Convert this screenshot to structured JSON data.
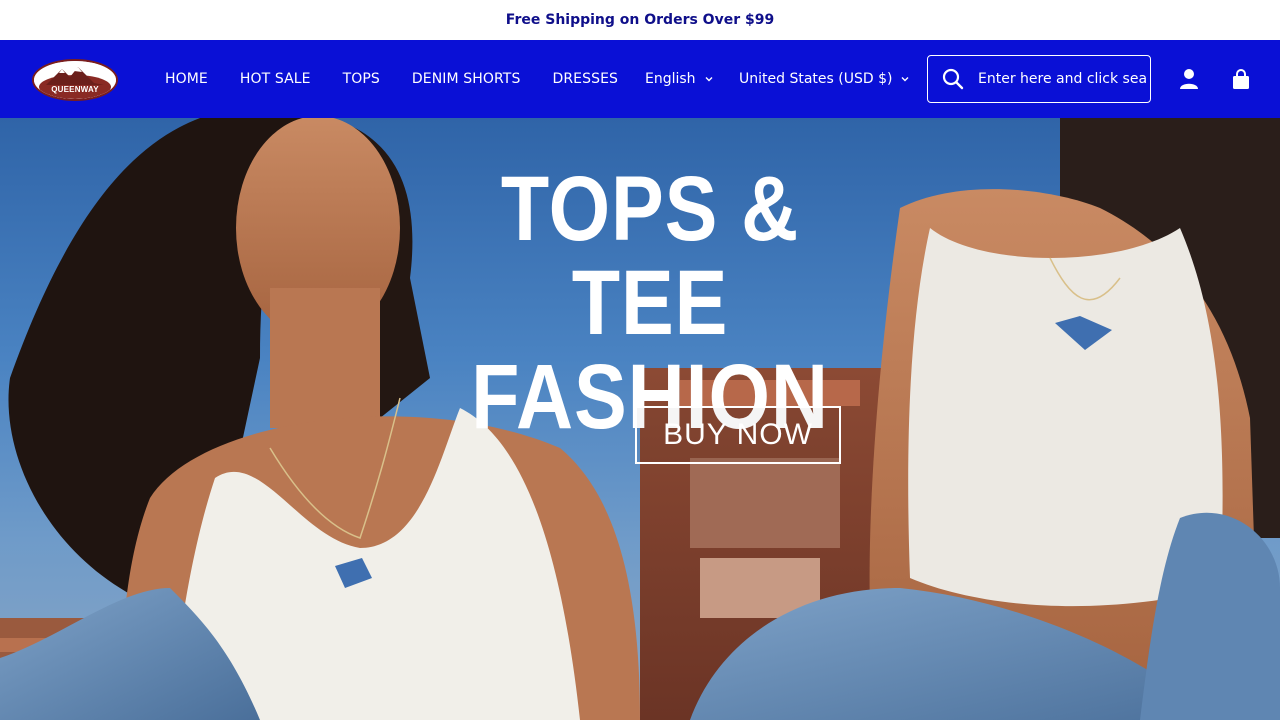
{
  "announcement": {
    "text": "Free Shipping on Orders Over $99"
  },
  "header": {
    "logo_text": "QUEENWAY",
    "nav": [
      {
        "label": "HOME"
      },
      {
        "label": "HOT SALE"
      },
      {
        "label": "TOPS"
      },
      {
        "label": "DENIM SHORTS"
      },
      {
        "label": "DRESSES"
      }
    ],
    "language": {
      "selected": "English"
    },
    "currency": {
      "selected": "United States (USD $)"
    },
    "search": {
      "placeholder": "Enter here and click sea"
    },
    "icons": [
      "search-icon",
      "account-icon",
      "cart-icon"
    ],
    "colors": {
      "header_bg": "#0a10d6",
      "announcement_text": "#0f0f8a"
    }
  },
  "hero": {
    "headline_line1": "TOPS & TEE",
    "headline_line2": "FASHION",
    "cta_label": "BUY NOW"
  }
}
